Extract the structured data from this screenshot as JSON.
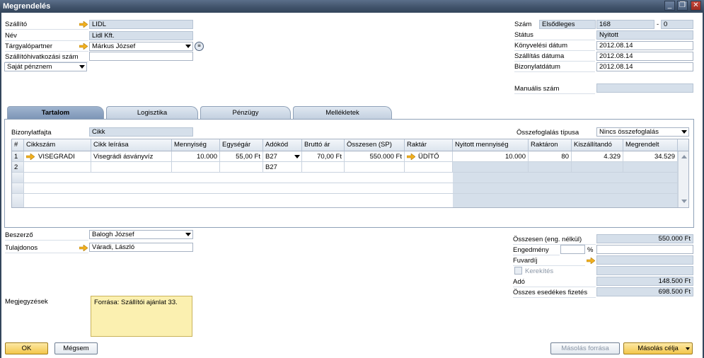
{
  "window": {
    "title": "Megrendelés",
    "min": "_",
    "max": "❐",
    "close": "✕"
  },
  "header_left": {
    "supplier_label": "Szállító",
    "supplier_value": "LIDL",
    "name_label": "Név",
    "name_value": "Lidl Kft.",
    "contact_label": "Tárgyalópartner",
    "contact_value": "Márkus József",
    "ref_label": "Szállítóhivatkozási szám",
    "ref_value": "",
    "currency_value": "Saját pénznem"
  },
  "header_right": {
    "number_label": "Szám",
    "series_value": "Elsődleges",
    "number_value": "168",
    "dash": "-",
    "suffix_value": "0",
    "status_label": "Státus",
    "status_value": "Nyitott",
    "posting_label": "Könyvelési dátum",
    "posting_value": "2012.08.14",
    "delivery_label": "Szállítás dátuma",
    "delivery_value": "2012.08.14",
    "doc_date_label": "Bizonylatdátum",
    "doc_date_value": "2012.08.14",
    "manual_label": "Manuális szám",
    "manual_value": ""
  },
  "tabs": [
    "Tartalom",
    "Logisztika",
    "Pénzügy",
    "Mellékletek"
  ],
  "content": {
    "doctype_label": "Bizonylatfajta",
    "doctype_value": "Cikk",
    "summary_label": "Összefoglalás típusa",
    "summary_value": "Nincs összefoglalás"
  },
  "grid": {
    "columns": [
      "#",
      "Cikkszám",
      "Cikk leírása",
      "Mennyiség",
      "Egységár",
      "Adókód",
      "Bruttó ár",
      "Összesen (SP)",
      "Raktár",
      "Nyitott mennyiség",
      "Raktáron",
      "Kiszállítandó",
      "Megrendelt"
    ],
    "rows": [
      [
        "1",
        "VISEGRADI",
        "Visegrádi ásványvíz",
        "10.000",
        "55,00 Ft",
        "B27",
        "70,00 Ft",
        "550.000 Ft",
        "ÜDÍTŐ",
        "10.000",
        "80",
        "4.329",
        "34.529"
      ],
      [
        "2",
        "",
        "",
        "",
        "",
        "B27",
        "",
        "",
        "",
        "",
        "",
        "",
        ""
      ]
    ]
  },
  "footer_left": {
    "buyer_label": "Beszerző",
    "buyer_value": "Balogh József",
    "owner_label": "Tulajdonos",
    "owner_value": "Váradi, László",
    "remarks_label": "Megjegyzések",
    "remarks_value": "Forrása: Szállítói ajánlat 33."
  },
  "totals": {
    "before_discount_label": "Összesen (eng. nélkül)",
    "before_discount_value": "550.000 Ft",
    "discount_label": "Engedmény",
    "discount_pct": "",
    "pct_sign": "%",
    "discount_value": "",
    "freight_label": "Fuvardíj",
    "freight_value": "",
    "rounding_label": "Kerekítés",
    "rounding_value": "",
    "tax_label": "Adó",
    "tax_value": "148.500 Ft",
    "total_label": "Összes esedékes fizetés",
    "total_value": "698.500 Ft"
  },
  "buttons": {
    "ok": "OK",
    "cancel": "Mégsem",
    "copy_from": "Másolás forrása",
    "copy_to": "Másolás célja"
  }
}
